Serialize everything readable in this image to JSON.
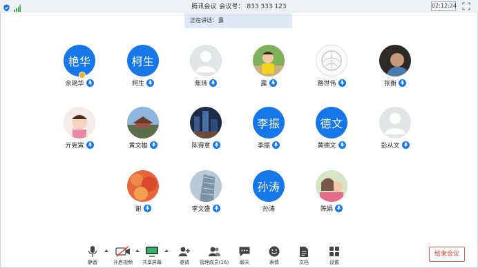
{
  "titlebar": {
    "app_name": "腾讯会议",
    "meeting_label": "会议号：",
    "meeting_id": "833 333 123",
    "time": "02:12:24"
  },
  "speaking": {
    "label": "正在讲话：",
    "name": "露"
  },
  "participants": [
    {
      "name": "佘艳华",
      "avatar_text": "艳华",
      "avatar": "text",
      "host": true
    },
    {
      "name": "柯生",
      "avatar_text": "柯生",
      "avatar": "text"
    },
    {
      "name": "焦玮",
      "avatar": "default"
    },
    {
      "name": "露",
      "avatar": "photo-child-yellow"
    },
    {
      "name": "路世伟",
      "avatar": "photo-sketch"
    },
    {
      "name": "张衡",
      "avatar": "photo-dark"
    },
    {
      "name": "亓宪寅",
      "avatar": "photo-baby"
    },
    {
      "name": "黄文雄",
      "avatar": "photo-temple"
    },
    {
      "name": "陈得意",
      "avatar": "photo-city-night"
    },
    {
      "name": "李振",
      "avatar_text": "李振",
      "avatar": "text"
    },
    {
      "name": "黄德文",
      "avatar_text": "德文",
      "avatar": "text"
    },
    {
      "name": "彭从文",
      "avatar": "default"
    },
    {
      "name": "谢",
      "avatar": "photo-autumn"
    },
    {
      "name": "李文盛",
      "avatar": "photo-building"
    },
    {
      "name": "孙涛",
      "avatar_text": "孙涛",
      "avatar": "text"
    },
    {
      "name": "陈娟",
      "avatar": "photo-girls"
    }
  ],
  "toolbar": {
    "mute": "静音",
    "start_video": "开启视频",
    "share_screen": "共享屏幕",
    "invite": "邀请",
    "manage_members": "管理成员(16)",
    "chat": "聊天",
    "reactions": "表情",
    "docs": "文档",
    "settings": "设置",
    "end_meeting": "结束会议"
  },
  "colors": {
    "accent": "#1677e8",
    "danger": "#e0423b",
    "banner": "#dfeaf8"
  }
}
